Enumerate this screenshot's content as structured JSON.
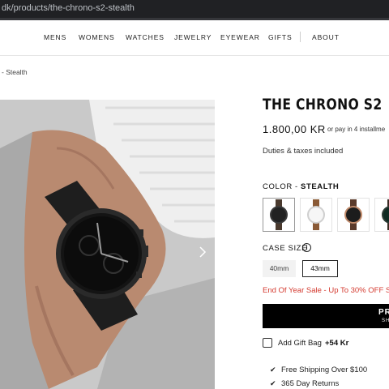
{
  "browser": {
    "url": "dk/products/the-chrono-s2-stealth"
  },
  "nav": {
    "items": [
      "MENS",
      "WOMENS",
      "WATCHES",
      "JEWELRY",
      "EYEWEAR",
      "GIFTS",
      "ABOUT"
    ]
  },
  "breadcrumb": {
    "text": "- Stealth"
  },
  "product": {
    "title": "THE CHRONO S2",
    "price": "1.800,00 KR",
    "installments": "or pay in 4 installme",
    "duties": "Duties & taxes included"
  },
  "color": {
    "label": "COLOR - ",
    "selected": "STEALTH",
    "swatches": [
      "stealth",
      "silver-white",
      "black-rose-gold",
      "black-green"
    ]
  },
  "case_size": {
    "label": "CASE SIZE",
    "options": [
      "40mm",
      "43mm"
    ],
    "selected": "43mm"
  },
  "sale": {
    "text": "End Of Year Sale - Up To 30% OFF S"
  },
  "buy_button": {
    "line1": "PR",
    "line2": "SH"
  },
  "gift": {
    "label": "Add Gift Bag",
    "price": "+54 Kr"
  },
  "features": [
    "Free Shipping Over $100",
    "365 Day Returns"
  ],
  "colors": {
    "sale_red": "#d43a2f",
    "button_black": "#000000"
  }
}
